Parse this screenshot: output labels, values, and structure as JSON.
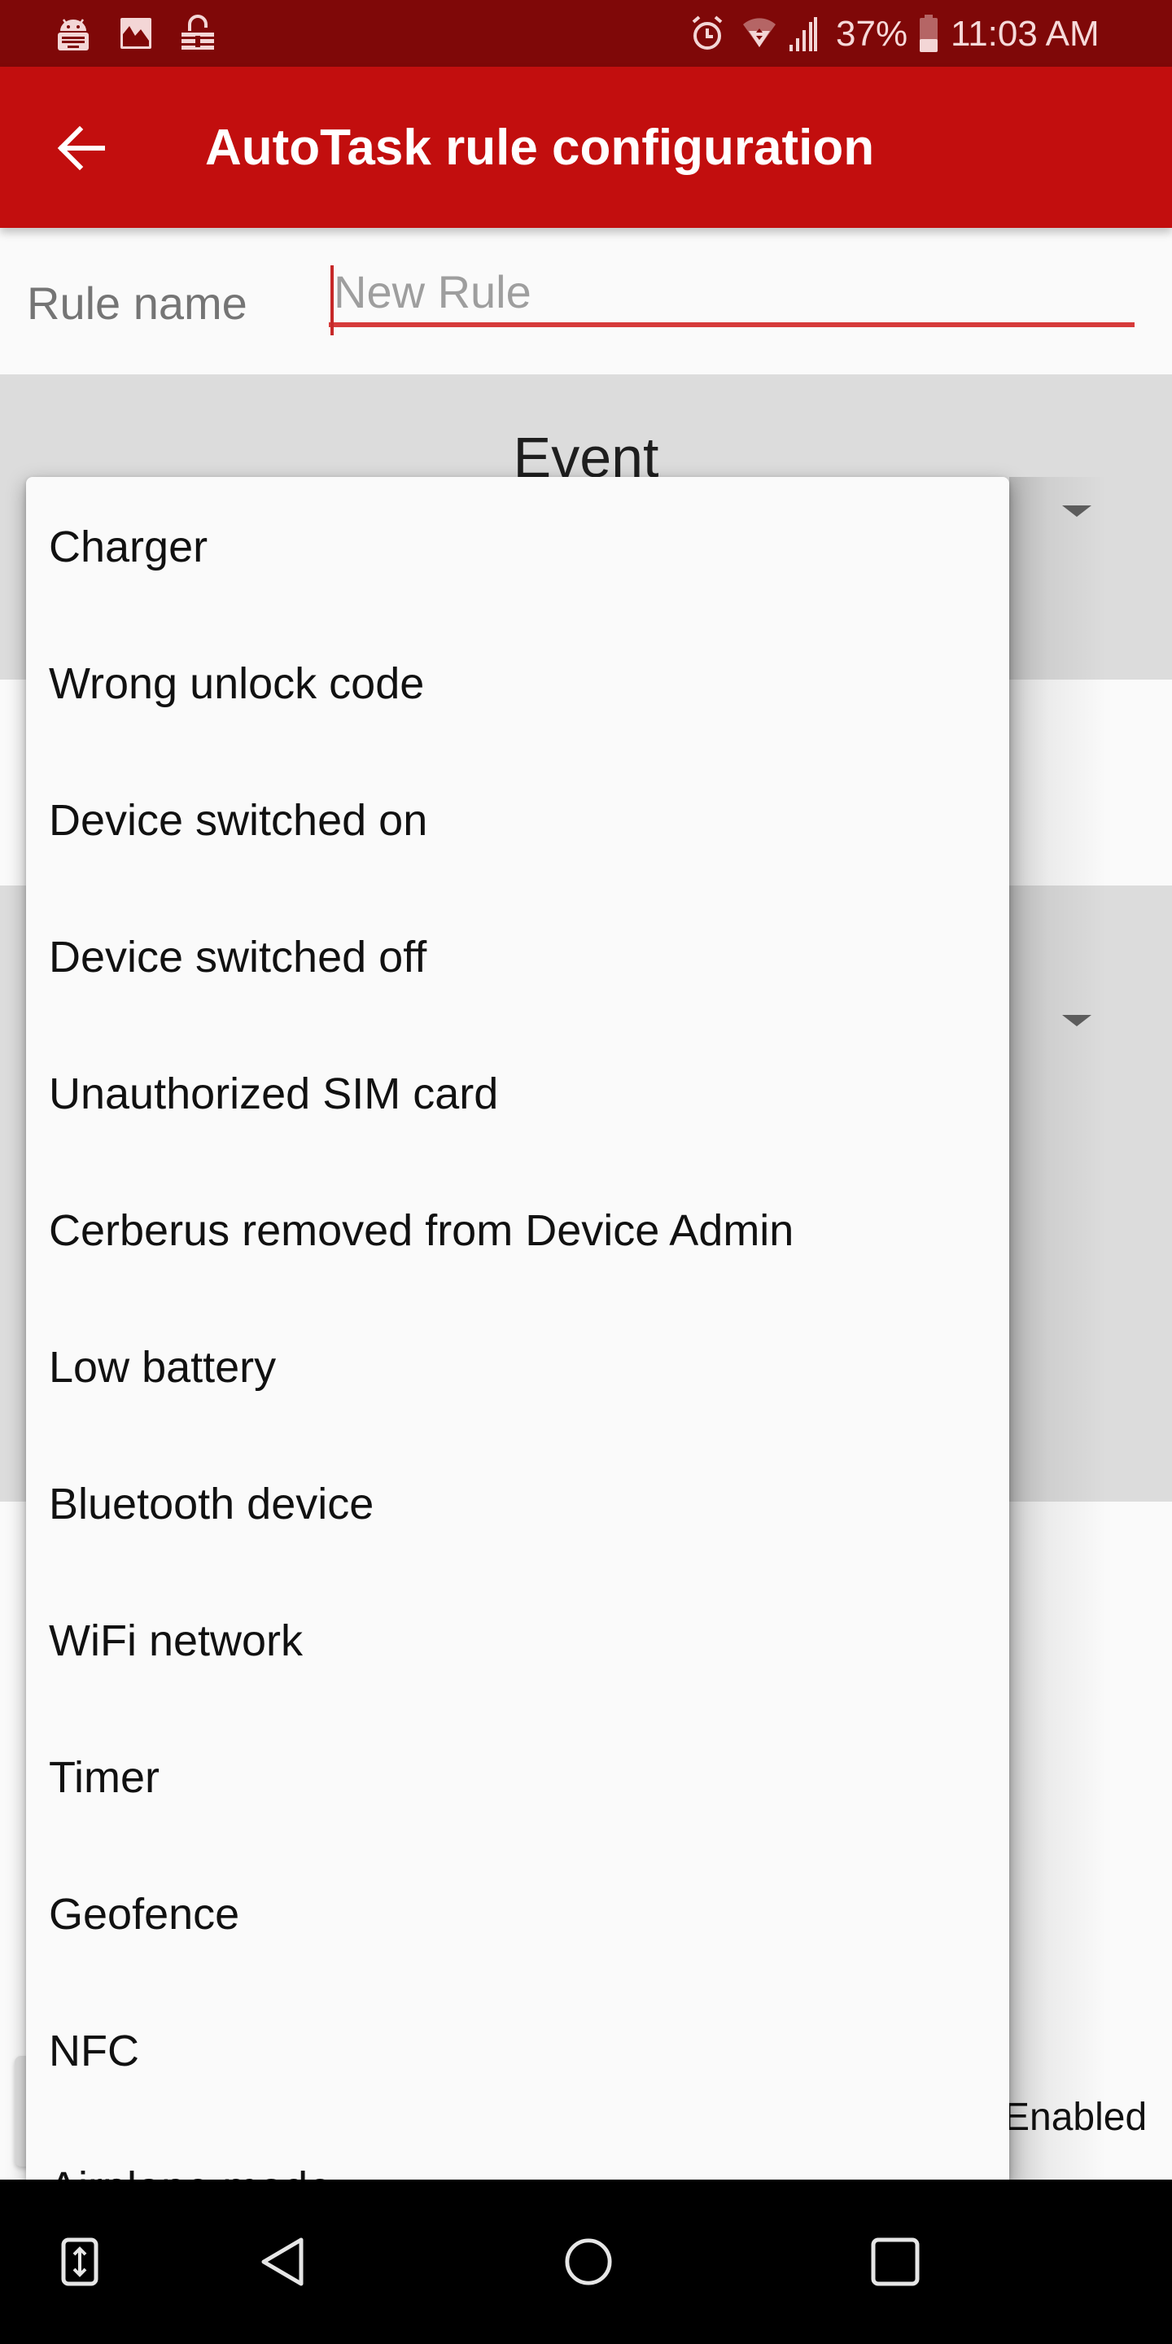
{
  "status_bar": {
    "left_icons": [
      "android-keyboard-icon",
      "image-icon",
      "vpn-lock-icon"
    ],
    "right_icons": [
      "alarm-icon",
      "wifi-icon",
      "signal-icon",
      "battery-icon"
    ],
    "battery_percent": "37%",
    "battery_level": 0.37,
    "time": "11:03 AM"
  },
  "app_bar": {
    "back_icon": "arrow-back-icon",
    "title": "AutoTask rule configuration"
  },
  "rule_name": {
    "label": "Rule name",
    "value": "",
    "placeholder": "New Rule"
  },
  "event_section": {
    "title": "Event"
  },
  "background": {
    "enabled_label": "Enabled"
  },
  "event_dropdown": {
    "options": [
      "Charger",
      "Wrong unlock code",
      "Device switched on",
      "Device switched off",
      "Unauthorized SIM card",
      "Cerberus removed from Device Admin",
      "Low battery",
      "Bluetooth device",
      "WiFi network",
      "Timer",
      "Geofence",
      "NFC",
      "Airplane mode"
    ]
  },
  "nav_bar": {
    "buttons": [
      "keyboard-switch-icon",
      "back-icon",
      "home-icon",
      "recents-icon"
    ]
  },
  "colors": {
    "status_bar": "#7f0808",
    "app_bar": "#c20e0e",
    "accent_underline": "#d63a3a",
    "section_gray": "#dcdcdc",
    "surface": "#fafafa"
  }
}
